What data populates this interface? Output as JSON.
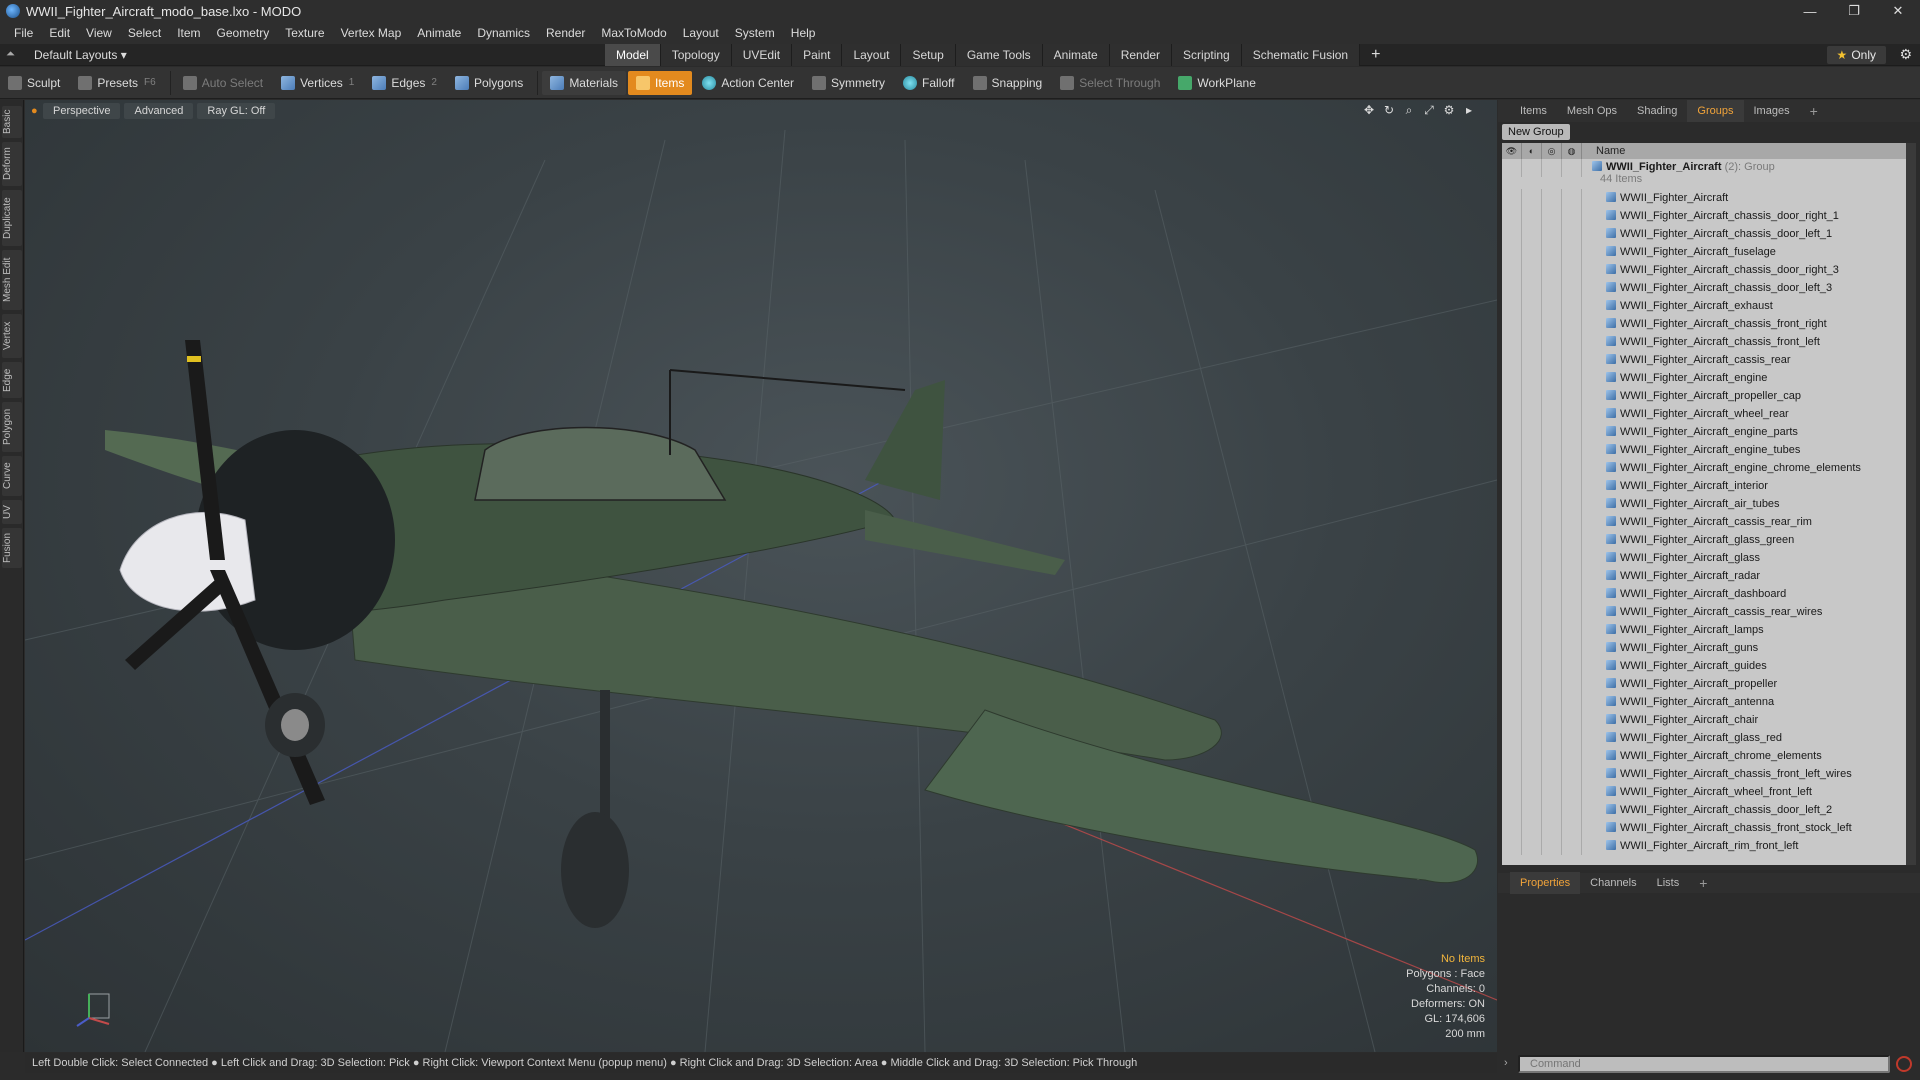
{
  "window": {
    "title": "WWII_Fighter_Aircraft_modo_base.lxo - MODO",
    "controls": [
      "—",
      "❐",
      "✕"
    ]
  },
  "menu": [
    "File",
    "Edit",
    "View",
    "Select",
    "Item",
    "Geometry",
    "Texture",
    "Vertex Map",
    "Animate",
    "Dynamics",
    "Render",
    "MaxToModo",
    "Layout",
    "System",
    "Help"
  ],
  "layoutbar": {
    "layout_select": "Default Layouts ▾",
    "tabs": [
      "Model",
      "Topology",
      "UVEdit",
      "Paint",
      "Layout",
      "Setup",
      "Game Tools",
      "Animate",
      "Render",
      "Scripting",
      "Schematic Fusion"
    ],
    "active_tab": "Model",
    "plus": "+",
    "only_star": "★",
    "only_label": "Only"
  },
  "toolbar": {
    "sculpt": "Sculpt",
    "presets": "Presets",
    "presets_key": "F6",
    "auto_select": "Auto Select",
    "vertices": "Vertices",
    "vertices_key": "1",
    "edges": "Edges",
    "edges_key": "2",
    "polygons": "Polygons",
    "materials": "Materials",
    "items": "Items",
    "action_center": "Action Center",
    "symmetry": "Symmetry",
    "falloff": "Falloff",
    "snapping": "Snapping",
    "select_through": "Select Through",
    "workplane": "WorkPlane"
  },
  "left_tabs": [
    "Basic",
    "Deform",
    "Duplicate",
    "Mesh Edit",
    "Vertex",
    "Edge",
    "Polygon",
    "Curve",
    "UV",
    "Fusion"
  ],
  "viewport": {
    "perspective": "Perspective",
    "advanced": "Advanced",
    "raygl": "Ray GL: Off",
    "info": {
      "no_items": "No Items",
      "polygons": "Polygons : Face",
      "channels": "Channels: 0",
      "deformers": "Deformers: ON",
      "gl": "GL: 174,606",
      "scale": "200 mm"
    }
  },
  "statusbar": "Left Double Click: Select Connected ● Left Click and Drag: 3D Selection: Pick ● Right Click: Viewport Context Menu (popup menu) ● Right Click and Drag: 3D Selection: Area ● Middle Click and Drag: 3D Selection: Pick Through",
  "right_panel": {
    "tabs": [
      "Items",
      "Mesh Ops",
      "Shading",
      "Groups",
      "Images",
      "+"
    ],
    "active_tab": "Groups",
    "new_group": "New Group",
    "name_header": "Name",
    "group": {
      "name": "WWII_Fighter_Aircraft",
      "count": "(2)",
      "type": ": Group",
      "sub": "44 Items"
    },
    "items": [
      "WWII_Fighter_Aircraft",
      "WWII_Fighter_Aircraft_chassis_door_right_1",
      "WWII_Fighter_Aircraft_chassis_door_left_1",
      "WWII_Fighter_Aircraft_fuselage",
      "WWII_Fighter_Aircraft_chassis_door_right_3",
      "WWII_Fighter_Aircraft_chassis_door_left_3",
      "WWII_Fighter_Aircraft_exhaust",
      "WWII_Fighter_Aircraft_chassis_front_right",
      "WWII_Fighter_Aircraft_chassis_front_left",
      "WWII_Fighter_Aircraft_cassis_rear",
      "WWII_Fighter_Aircraft_engine",
      "WWII_Fighter_Aircraft_propeller_cap",
      "WWII_Fighter_Aircraft_wheel_rear",
      "WWII_Fighter_Aircraft_engine_parts",
      "WWII_Fighter_Aircraft_engine_tubes",
      "WWII_Fighter_Aircraft_engine_chrome_elements",
      "WWII_Fighter_Aircraft_interior",
      "WWII_Fighter_Aircraft_air_tubes",
      "WWII_Fighter_Aircraft_cassis_rear_rim",
      "WWII_Fighter_Aircraft_glass_green",
      "WWII_Fighter_Aircraft_glass",
      "WWII_Fighter_Aircraft_radar",
      "WWII_Fighter_Aircraft_dashboard",
      "WWII_Fighter_Aircraft_cassis_rear_wires",
      "WWII_Fighter_Aircraft_lamps",
      "WWII_Fighter_Aircraft_guns",
      "WWII_Fighter_Aircraft_guides",
      "WWII_Fighter_Aircraft_propeller",
      "WWII_Fighter_Aircraft_antenna",
      "WWII_Fighter_Aircraft_chair",
      "WWII_Fighter_Aircraft_glass_red",
      "WWII_Fighter_Aircraft_chrome_elements",
      "WWII_Fighter_Aircraft_chassis_front_left_wires",
      "WWII_Fighter_Aircraft_wheel_front_left",
      "WWII_Fighter_Aircraft_chassis_door_left_2",
      "WWII_Fighter_Aircraft_chassis_front_stock_left",
      "WWII_Fighter_Aircraft_rim_front_left"
    ],
    "bottom_tabs": [
      "Properties",
      "Channels",
      "Lists",
      "+"
    ],
    "bottom_active": "Properties",
    "command_placeholder": "Command"
  },
  "colors": {
    "accent": "#e38a1e",
    "active_tab_text": "#f0a33a",
    "viewport_bg": "#3a4246"
  }
}
